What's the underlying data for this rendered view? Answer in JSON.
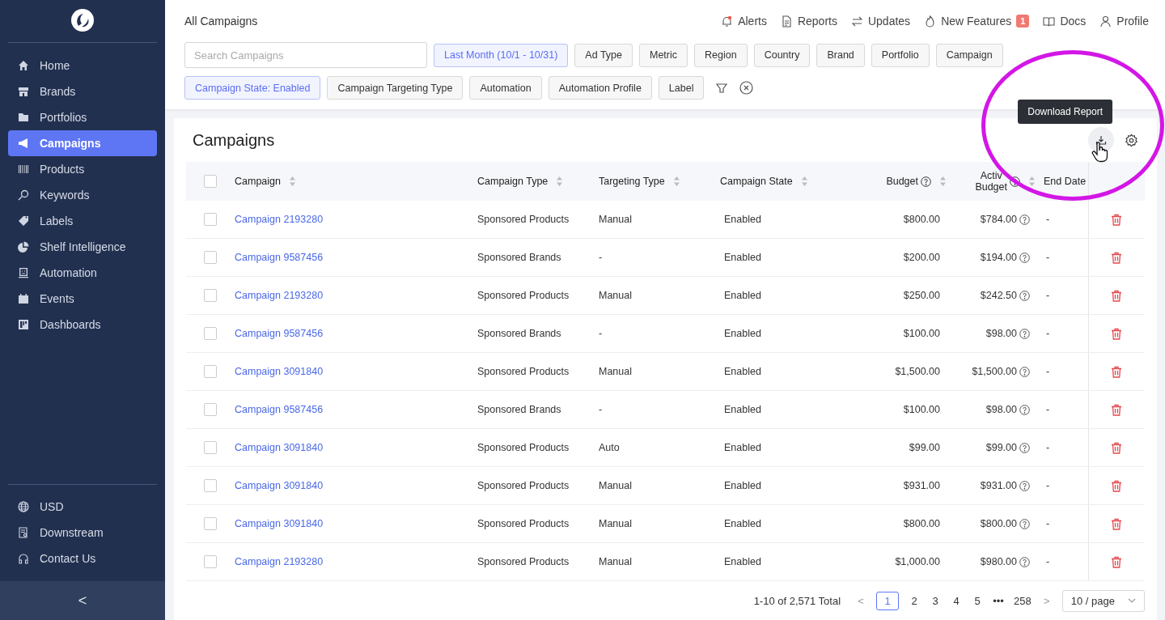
{
  "sidebar": {
    "items": [
      {
        "label": "Home",
        "selected": false
      },
      {
        "label": "Brands",
        "selected": false
      },
      {
        "label": "Portfolios",
        "selected": false
      },
      {
        "label": "Campaigns",
        "selected": true
      },
      {
        "label": "Products",
        "selected": false
      },
      {
        "label": "Keywords",
        "selected": false
      },
      {
        "label": "Labels",
        "selected": false
      },
      {
        "label": "Shelf Intelligence",
        "selected": false
      },
      {
        "label": "Automation",
        "selected": false
      },
      {
        "label": "Events",
        "selected": false
      },
      {
        "label": "Dashboards",
        "selected": false
      }
    ],
    "bottom_items": [
      {
        "label": "USD"
      },
      {
        "label": "Downstream"
      },
      {
        "label": "Contact Us"
      }
    ],
    "collapse": "<"
  },
  "header": {
    "breadcrumb": "All Campaigns",
    "links": [
      {
        "label": "Alerts"
      },
      {
        "label": "Reports"
      },
      {
        "label": "Updates"
      },
      {
        "label": "New Features",
        "badge": "1"
      },
      {
        "label": "Docs"
      },
      {
        "label": "Profile"
      }
    ]
  },
  "filters": {
    "search": {
      "placeholder": "Search Campaigns"
    },
    "chips": [
      {
        "label": "Last Month (10/1 - 10/31)",
        "active": true
      },
      {
        "label": "Ad Type",
        "active": false
      },
      {
        "label": "Metric",
        "active": false
      },
      {
        "label": "Region",
        "active": false
      },
      {
        "label": "Country",
        "active": false
      },
      {
        "label": "Brand",
        "active": false
      },
      {
        "label": "Portfolio",
        "active": false
      },
      {
        "label": "Campaign",
        "active": false
      },
      {
        "label": "Campaign State: Enabled",
        "active": true
      },
      {
        "label": "Campaign Targeting Type",
        "active": false
      },
      {
        "label": "Automation",
        "active": false
      },
      {
        "label": "Automation Profile",
        "active": false
      },
      {
        "label": "Label",
        "active": false
      }
    ]
  },
  "table": {
    "title": "Campaigns",
    "tooltip": "Download Report",
    "all_checked": false,
    "columns": [
      {
        "label": "Campaign",
        "sortable": true,
        "help": false
      },
      {
        "label": "Campaign Type",
        "sortable": true,
        "help": false
      },
      {
        "label": "Targeting Type",
        "sortable": true,
        "help": false
      },
      {
        "label": "Campaign State",
        "sortable": true,
        "help": false
      },
      {
        "label": "Budget",
        "sortable": true,
        "help": true
      },
      {
        "label": "Activ",
        "label_2": "Budget",
        "sortable": true,
        "help": true
      },
      {
        "label": "End Date",
        "sortable": false,
        "help": false
      }
    ],
    "rows": [
      {
        "checked": false,
        "campaign": "Campaign 2193280",
        "type": "Sponsored Products",
        "targeting": "Manual",
        "state": "Enabled",
        "budget": "$800.00",
        "active_budget": "$784.00",
        "end_date": "-"
      },
      {
        "checked": false,
        "campaign": "Campaign 9587456",
        "type": "Sponsored Brands",
        "targeting": "-",
        "state": "Enabled",
        "budget": "$200.00",
        "active_budget": "$194.00",
        "end_date": "-"
      },
      {
        "checked": false,
        "campaign": "Campaign 2193280",
        "type": "Sponsored Products",
        "targeting": "Manual",
        "state": "Enabled",
        "budget": "$250.00",
        "active_budget": "$242.50",
        "end_date": "-"
      },
      {
        "checked": false,
        "campaign": "Campaign 9587456",
        "type": "Sponsored Brands",
        "targeting": "-",
        "state": "Enabled",
        "budget": "$100.00",
        "active_budget": "$98.00",
        "end_date": "-"
      },
      {
        "checked": false,
        "campaign": "Campaign 3091840",
        "type": "Sponsored Products",
        "targeting": "Manual",
        "state": "Enabled",
        "budget": "$1,500.00",
        "active_budget": "$1,500.00",
        "end_date": "-"
      },
      {
        "checked": false,
        "campaign": "Campaign 9587456",
        "type": "Sponsored Brands",
        "targeting": "-",
        "state": "Enabled",
        "budget": "$100.00",
        "active_budget": "$98.00",
        "end_date": "-"
      },
      {
        "checked": false,
        "campaign": "Campaign 3091840",
        "type": "Sponsored Products",
        "targeting": "Auto",
        "state": "Enabled",
        "budget": "$99.00",
        "active_budget": "$99.00",
        "end_date": "-"
      },
      {
        "checked": false,
        "campaign": "Campaign 3091840",
        "type": "Sponsored Products",
        "targeting": "Manual",
        "state": "Enabled",
        "budget": "$931.00",
        "active_budget": "$931.00",
        "end_date": "-"
      },
      {
        "checked": false,
        "campaign": "Campaign 3091840",
        "type": "Sponsored Products",
        "targeting": "Manual",
        "state": "Enabled",
        "budget": "$800.00",
        "active_budget": "$800.00",
        "end_date": "-"
      },
      {
        "checked": false,
        "campaign": "Campaign 2193280",
        "type": "Sponsored Products",
        "targeting": "Manual",
        "state": "Enabled",
        "budget": "$1,000.00",
        "active_budget": "$980.00",
        "end_date": "-"
      }
    ]
  },
  "pagination": {
    "summary": "1-10 of 2,571 Total",
    "prev": "<",
    "next": ">",
    "pages": [
      {
        "label": "1",
        "selected": true
      },
      {
        "label": "2",
        "selected": false
      },
      {
        "label": "3",
        "selected": false
      },
      {
        "label": "4",
        "selected": false
      },
      {
        "label": "5",
        "selected": false
      },
      {
        "label": "•••",
        "selected": false
      },
      {
        "label": "258",
        "selected": false
      }
    ],
    "page_size": "10 / page"
  }
}
